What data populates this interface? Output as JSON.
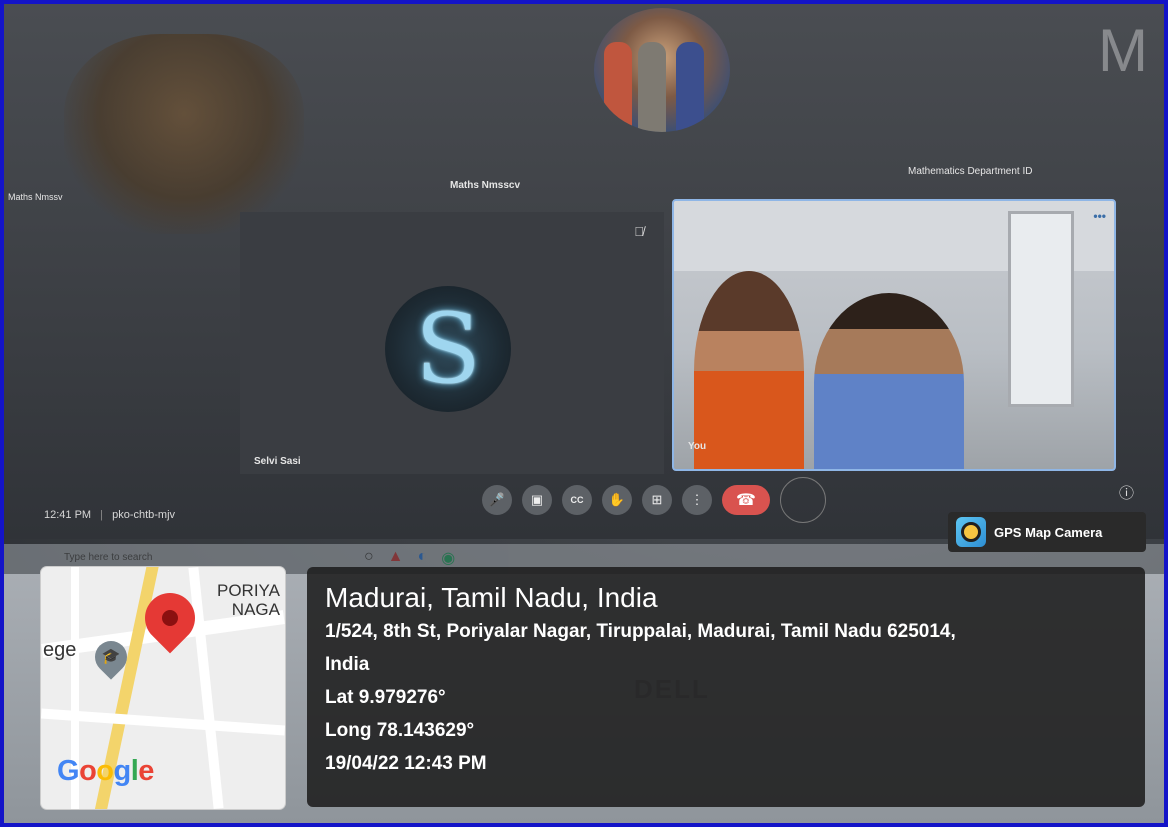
{
  "meeting": {
    "top_right_letter": "M",
    "participant_labels": {
      "far_left": "Maths Nmssv",
      "top_center": "Maths Nmsscv",
      "top_right": "Mathematics Department ID"
    },
    "tile_selvi": {
      "name": "Selvi Sasi",
      "avatar_letter": "S"
    },
    "tile_you": {
      "name": "You"
    },
    "meeting_time": "12:41 PM",
    "meeting_code": "pko-chtb-mjv",
    "controls": [
      "mic",
      "camera",
      "captions",
      "raise-hand",
      "present",
      "more",
      "end-call"
    ]
  },
  "taskbar": {
    "search_placeholder": "Type here to search"
  },
  "gps": {
    "app_name": "GPS Map Camera",
    "map_labels": [
      "PORIYA",
      "NAGA",
      "ege"
    ],
    "google_letters": [
      "G",
      "o",
      "o",
      "g",
      "l",
      "e"
    ],
    "google_colors": [
      "#4285f4",
      "#ea4335",
      "#fbbc05",
      "#4285f4",
      "#34a853",
      "#ea4335"
    ],
    "location_title": "Madurai, Tamil Nadu, India",
    "address_line_1": "1/524, 8th St, Poriyalar Nagar, Tiruppalai, Madurai, Tamil Nadu 625014,",
    "address_line_2": "India",
    "lat": "Lat 9.979276°",
    "long": "Long 78.143629°",
    "datetime": "19/04/22 12:43 PM"
  }
}
